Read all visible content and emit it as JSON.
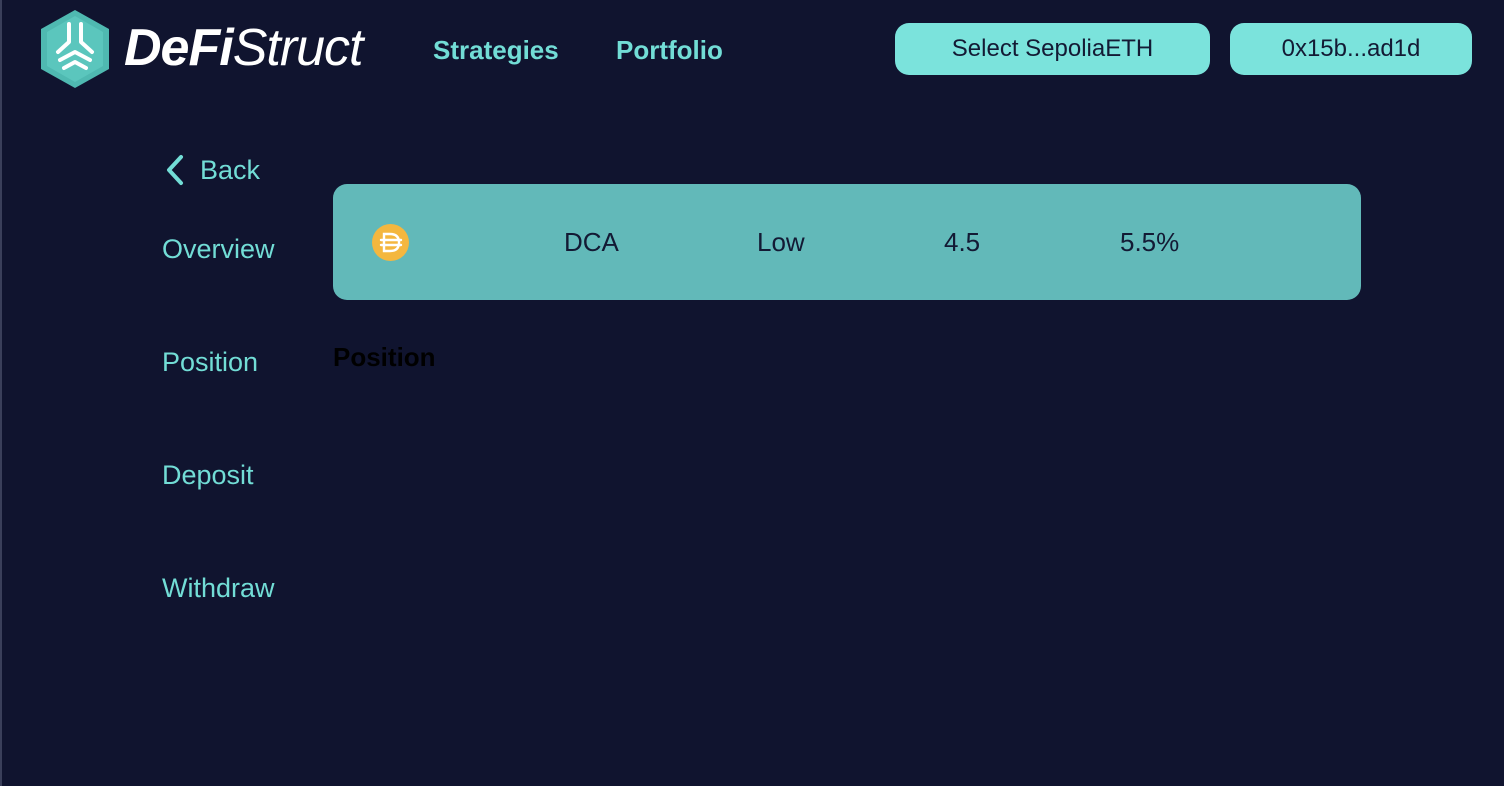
{
  "header": {
    "brand_bold": "DeFi",
    "brand_light": "Struct",
    "nav": {
      "strategies": "Strategies",
      "portfolio": "Portfolio"
    },
    "network_button": "Select SepoliaETH",
    "wallet_button": "0x15b...ad1d"
  },
  "sidebar": {
    "back_label": "Back",
    "items": [
      {
        "label": "Overview"
      },
      {
        "label": "Position"
      },
      {
        "label": "Deposit"
      },
      {
        "label": "Withdraw"
      }
    ]
  },
  "strategy": {
    "token_icon": "dai-coin-icon",
    "name": "DCA",
    "risk": "Low",
    "score": "4.5",
    "apy": "5.5%"
  },
  "section": {
    "title": "Position"
  },
  "colors": {
    "background": "#10142f",
    "accent": "#72ddd6",
    "button": "#7be3dc",
    "card": "#62b9b9",
    "coin": "#f4b73f"
  }
}
